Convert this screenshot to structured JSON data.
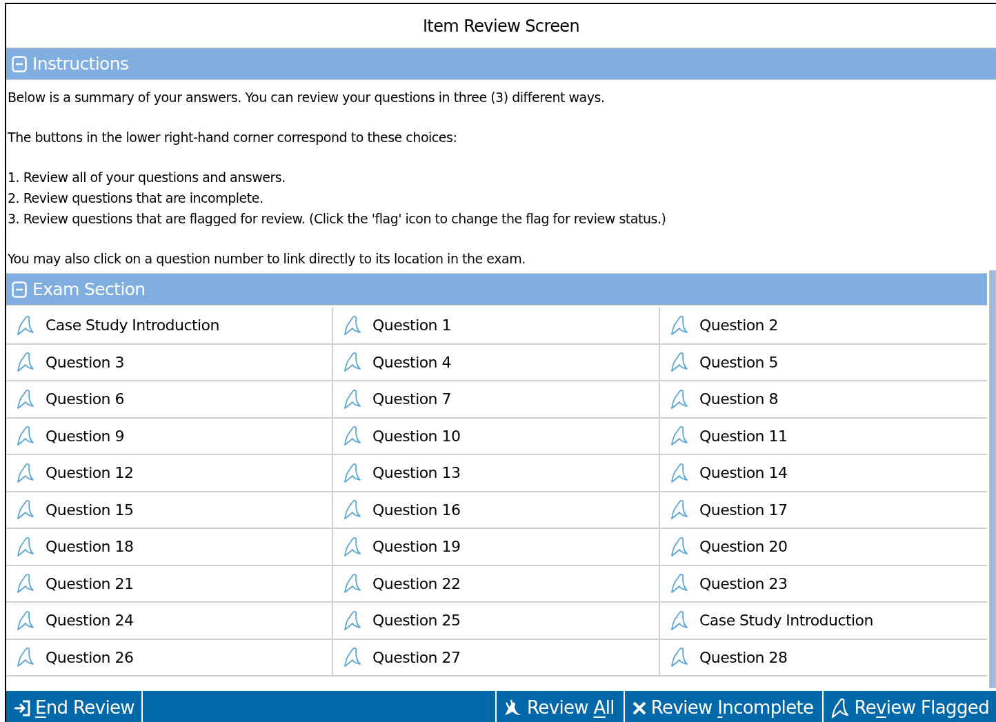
{
  "window": {
    "title": "Item Review Screen"
  },
  "instructions": {
    "header": "Instructions",
    "expanded": true,
    "paragraphs": [
      "Below is a summary of your answers. You can review your questions in three (3) different ways.",
      "The buttons in the lower right-hand corner correspond to these choices:",
      "1. Review all of your questions and answers.\n2. Review questions that are incomplete.\n3. Review questions that are flagged for review. (Click the 'flag' icon to change the flag for review status.)",
      "You may also click on a question number to link directly to its location in the exam."
    ]
  },
  "exam_section": {
    "header": "Exam Section",
    "expanded": true,
    "items": [
      {
        "label": "Case Study Introduction"
      },
      {
        "label": "Question 1"
      },
      {
        "label": "Question 2"
      },
      {
        "label": "Question 3"
      },
      {
        "label": "Question 4"
      },
      {
        "label": "Question 5"
      },
      {
        "label": "Question 6"
      },
      {
        "label": "Question 7"
      },
      {
        "label": "Question 8"
      },
      {
        "label": "Question 9"
      },
      {
        "label": "Question 10"
      },
      {
        "label": "Question 11"
      },
      {
        "label": "Question 12"
      },
      {
        "label": "Question 13"
      },
      {
        "label": "Question 14"
      },
      {
        "label": "Question 15"
      },
      {
        "label": "Question 16"
      },
      {
        "label": "Question 17"
      },
      {
        "label": "Question 18"
      },
      {
        "label": "Question 19"
      },
      {
        "label": "Question 20"
      },
      {
        "label": "Question 21"
      },
      {
        "label": "Question 22"
      },
      {
        "label": "Question 23"
      },
      {
        "label": "Question 24"
      },
      {
        "label": "Question 25"
      },
      {
        "label": "Case Study Introduction"
      },
      {
        "label": "Question 26"
      },
      {
        "label": "Question 27"
      },
      {
        "label": "Question 28"
      }
    ]
  },
  "footer": {
    "left_buttons": [
      {
        "kind": "end",
        "access_key": "E",
        "label_after": "nd Review"
      }
    ],
    "right_buttons": [
      {
        "kind": "all",
        "label_before": "Review ",
        "access_key": "A",
        "label_after": "ll"
      },
      {
        "kind": "incomplete",
        "label_before": "Review ",
        "access_key": "I",
        "label_after": "ncomplete"
      },
      {
        "kind": "flagged",
        "label_before": "Re",
        "access_key": "v",
        "label_after": "iew Flagged"
      }
    ]
  }
}
